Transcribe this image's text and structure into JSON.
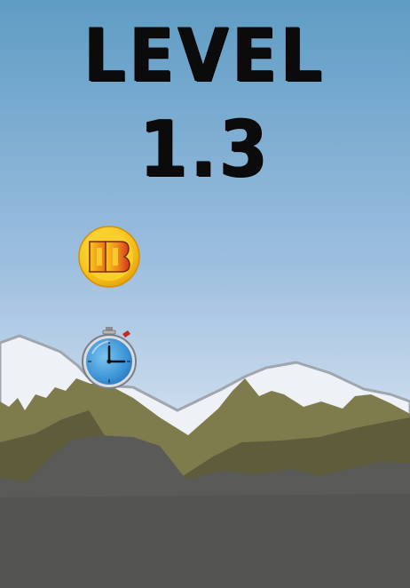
{
  "level": {
    "title": "LEVEL",
    "number": "1.3"
  },
  "pickups": {
    "coin_icon": "bb-coin-icon",
    "timer_icon": "stopwatch-icon"
  },
  "colors": {
    "sky_top": "#5f9cc4",
    "sky_bottom": "#d8e4f1",
    "mountain_far_olive": "#7e7c4d",
    "mountain_mid_olive": "#5e5c3a",
    "rock_gray": "#5a5a58",
    "snow": "#eef1f5",
    "coin_yellow": "#f6c21a",
    "coin_red": "#d8341c",
    "watch_blue": "#3b94d6"
  }
}
